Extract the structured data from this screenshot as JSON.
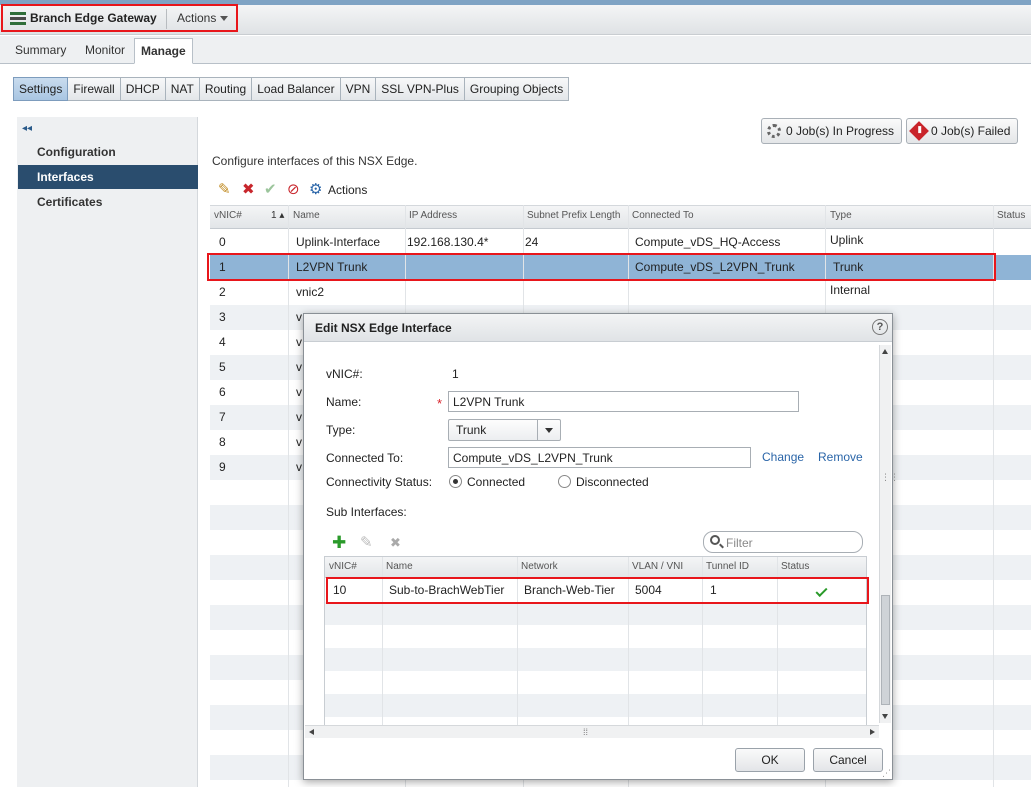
{
  "header": {
    "app_title": "Branch Edge Gateway",
    "actions_label": "Actions"
  },
  "tabs": [
    "Summary",
    "Monitor",
    "Manage"
  ],
  "subtabs": [
    "Settings",
    "Firewall",
    "DHCP",
    "NAT",
    "Routing",
    "Load Balancer",
    "VPN",
    "SSL VPN-Plus",
    "Grouping Objects"
  ],
  "nav": {
    "collapse_glyph": "◂◂",
    "items": [
      "Configuration",
      "Interfaces",
      "Certificates"
    ]
  },
  "jobs": {
    "in_progress": "0 Job(s) In Progress",
    "failed": "0 Job(s) Failed"
  },
  "description": "Configure interfaces of this NSX Edge.",
  "toolbar": {
    "actions_label": "Actions"
  },
  "grid": {
    "headers": {
      "vnic": "vNIC#",
      "sort": "1 ▴",
      "name": "Name",
      "ip": "IP Address",
      "subnet": "Subnet Prefix Length",
      "connected": "Connected To",
      "type": "Type",
      "status": "Status"
    },
    "rows": [
      {
        "vnic": "0",
        "name": "Uplink-Interface",
        "ip": "192.168.130.4*",
        "subnet": "24",
        "connected": "Compute_vDS_HQ-Access",
        "type": "Uplink"
      },
      {
        "vnic": "1",
        "name": "L2VPN Trunk",
        "ip": "",
        "subnet": "",
        "connected": "Compute_vDS_L2VPN_Trunk",
        "type": "Trunk"
      },
      {
        "vnic": "2",
        "name": "vnic2",
        "ip": "",
        "subnet": "",
        "connected": "",
        "type": "Internal"
      },
      {
        "vnic": "3",
        "name": "v",
        "ip": "",
        "subnet": "",
        "connected": "",
        "type": ""
      },
      {
        "vnic": "4",
        "name": "v",
        "ip": "",
        "subnet": "",
        "connected": "",
        "type": ""
      },
      {
        "vnic": "5",
        "name": "v",
        "ip": "",
        "subnet": "",
        "connected": "",
        "type": ""
      },
      {
        "vnic": "6",
        "name": "v",
        "ip": "",
        "subnet": "",
        "connected": "",
        "type": ""
      },
      {
        "vnic": "7",
        "name": "v",
        "ip": "",
        "subnet": "",
        "connected": "",
        "type": ""
      },
      {
        "vnic": "8",
        "name": "v",
        "ip": "",
        "subnet": "",
        "connected": "",
        "type": ""
      },
      {
        "vnic": "9",
        "name": "v",
        "ip": "",
        "subnet": "",
        "connected": "",
        "type": ""
      }
    ]
  },
  "dialog": {
    "title": "Edit NSX Edge Interface",
    "help_glyph": "?",
    "vnic_label": "vNIC#:",
    "vnic_value": "1",
    "name_label": "Name:",
    "name_required": "*",
    "name_value": "L2VPN Trunk",
    "type_label": "Type:",
    "type_value": "Trunk",
    "connected_label": "Connected To:",
    "connected_value": "Compute_vDS_L2VPN_Trunk",
    "change_link": "Change",
    "remove_link": "Remove",
    "status_label": "Connectivity Status:",
    "radio_connected": "Connected",
    "radio_disconnected": "Disconnected",
    "sub_label": "Sub Interfaces:",
    "filter_placeholder": "Filter",
    "sub_headers": {
      "vnic": "vNIC#",
      "name": "Name",
      "network": "Network",
      "vlan": "VLAN / VNI",
      "tunnel": "Tunnel ID",
      "status": "Status"
    },
    "sub_rows": [
      {
        "vnic": "10",
        "name": "Sub-to-BrachWebTier",
        "network": "Branch-Web-Tier",
        "vlan": "5004",
        "tunnel": "1"
      }
    ],
    "ok_label": "OK",
    "cancel_label": "Cancel"
  },
  "colors": {
    "highlight_red": "#e8161b",
    "selected_row": "#8fb4d6",
    "nav_active": "#2a4d6e",
    "link": "#2a65a8"
  }
}
